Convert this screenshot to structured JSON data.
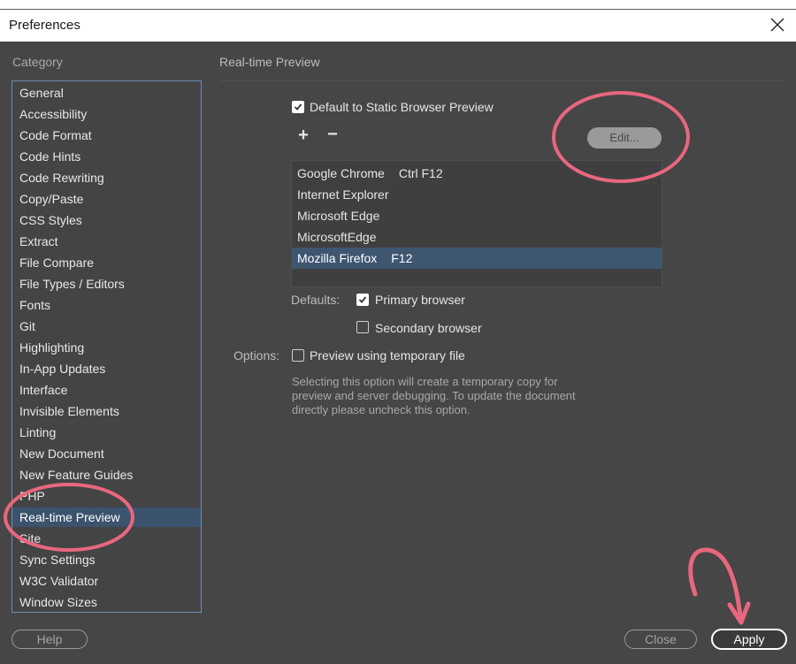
{
  "window": {
    "title": "Preferences"
  },
  "sidebar": {
    "heading": "Category",
    "items": [
      {
        "label": "General"
      },
      {
        "label": "Accessibility"
      },
      {
        "label": "Code Format"
      },
      {
        "label": "Code Hints"
      },
      {
        "label": "Code Rewriting"
      },
      {
        "label": "Copy/Paste"
      },
      {
        "label": "CSS Styles"
      },
      {
        "label": "Extract"
      },
      {
        "label": "File Compare"
      },
      {
        "label": "File Types / Editors"
      },
      {
        "label": "Fonts"
      },
      {
        "label": "Git"
      },
      {
        "label": "Highlighting"
      },
      {
        "label": "In-App Updates"
      },
      {
        "label": "Interface"
      },
      {
        "label": "Invisible Elements"
      },
      {
        "label": "Linting"
      },
      {
        "label": "New Document"
      },
      {
        "label": "New Feature Guides"
      },
      {
        "label": "PHP"
      },
      {
        "label": "Real-time Preview"
      },
      {
        "label": "Site"
      },
      {
        "label": "Sync Settings"
      },
      {
        "label": "W3C Validator"
      },
      {
        "label": "Window Sizes"
      }
    ],
    "selected_index": 20
  },
  "panel": {
    "title": "Real-time Preview",
    "default_static": {
      "label": "Default to Static Browser Preview",
      "checked": true
    },
    "add_symbol": "+",
    "remove_symbol": "−",
    "edit_label": "Edit...",
    "browsers": [
      {
        "name": "Google Chrome",
        "key": "Ctrl F12"
      },
      {
        "name": "Internet Explorer",
        "key": ""
      },
      {
        "name": "Microsoft Edge",
        "key": ""
      },
      {
        "name": "MicrosoftEdge",
        "key": ""
      },
      {
        "name": "Mozilla Firefox",
        "key": "F12"
      }
    ],
    "selected_browser_index": 4,
    "defaults_label": "Defaults:",
    "primary_browser": {
      "label": "Primary browser",
      "checked": true
    },
    "secondary_browser": {
      "label": "Secondary browser",
      "checked": false
    },
    "options_label": "Options:",
    "temp_file": {
      "label": "Preview using temporary file",
      "checked": false
    },
    "help_text": "Selecting this option will create a temporary copy for preview and server debugging. To update the document directly please uncheck this option."
  },
  "footer": {
    "help_label": "Help",
    "close_label": "Close",
    "apply_label": "Apply"
  },
  "colors": {
    "background": "#464646",
    "selection": "#3c536e",
    "annotation": "#e8677e"
  },
  "icons": {
    "close": "close-icon",
    "check": "checkmark-icon",
    "add": "plus-icon",
    "remove": "minus-icon"
  }
}
